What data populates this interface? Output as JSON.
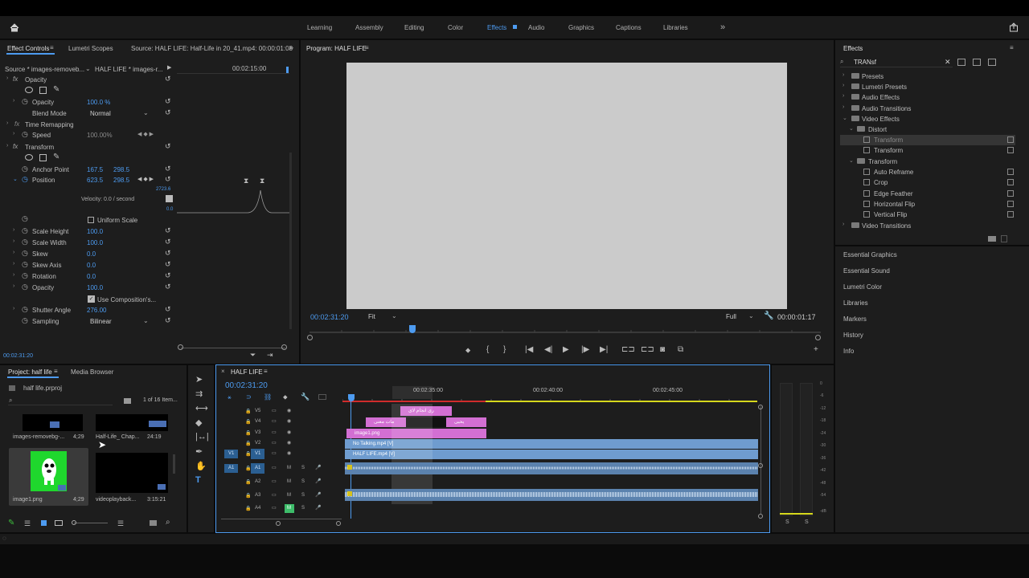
{
  "workspaces": {
    "items": [
      "Learning",
      "Assembly",
      "Editing",
      "Color",
      "Effects",
      "Audio",
      "Graphics",
      "Captions",
      "Libraries"
    ],
    "active": "Effects",
    "more": "»"
  },
  "ec": {
    "tabs": [
      "Effect Controls",
      "Lumetri Scopes",
      "Source: HALF LIFE: Half-Life in 20_41.mp4: 00:00:01:08"
    ],
    "source_label": "Source * images-removeb...",
    "seq_label": "HALF LIFE * images-r...",
    "ruler_time": "00:02:15:00",
    "opacity_section": "Opacity",
    "opacity_label": "Opacity",
    "opacity_value": "100.0 %",
    "blend_label": "Blend Mode",
    "blend_value": "Normal",
    "time_remap": "Time Remapping",
    "speed_label": "Speed",
    "speed_value": "100.00%",
    "transform_section": "Transform",
    "anchor_label": "Anchor Point",
    "anchor_x": "167.5",
    "anchor_y": "298.5",
    "position_label": "Position",
    "position_x": "623.5",
    "position_y": "298.5",
    "graph_max": "2723.6",
    "velocity": "Velocity: 0.0 / second",
    "graph_zero": "0.0",
    "uniform_scale": "Uniform Scale",
    "scale_height_label": "Scale Height",
    "scale_height": "100.0",
    "scale_width_label": "Scale Width",
    "scale_width": "100.0",
    "skew_label": "Skew",
    "skew": "0.0",
    "skew_axis_label": "Skew Axis",
    "skew_axis": "0.0",
    "rotation_label": "Rotation",
    "rotation": "0.0",
    "opacity2_label": "Opacity",
    "opacity2": "100.0",
    "use_comp": "Use Composition's...",
    "shutter_label": "Shutter Angle",
    "shutter": "276.00",
    "sampling_label": "Sampling",
    "sampling": "Bilinear",
    "footer_time": "00:02:31:20"
  },
  "program": {
    "title": "Program: HALF LIFE",
    "timecode": "00:02:31:20",
    "fit": "Fit",
    "quality": "Full",
    "duration": "00:00:01:17"
  },
  "effects": {
    "title": "Effects",
    "search_value": "TRANsf",
    "tree": [
      {
        "label": "Presets",
        "level": 0,
        "sel": false
      },
      {
        "label": "Lumetri Presets",
        "level": 0,
        "sel": false
      },
      {
        "label": "Audio Effects",
        "level": 0,
        "sel": false
      },
      {
        "label": "Audio Transitions",
        "level": 0,
        "sel": false
      },
      {
        "label": "Video Effects",
        "level": 0,
        "sel": false
      },
      {
        "label": "Distort",
        "level": 1,
        "sel": false
      },
      {
        "label": "Transform",
        "level": 2,
        "sel": true
      },
      {
        "label": "Transform",
        "level": 2,
        "sel": false
      },
      {
        "label": "Transform",
        "level": 1,
        "sel": false
      },
      {
        "label": "Auto Reframe",
        "level": 2,
        "sel": false
      },
      {
        "label": "Crop",
        "level": 2,
        "sel": false
      },
      {
        "label": "Edge Feather",
        "level": 2,
        "sel": false
      },
      {
        "label": "Horizontal Flip",
        "level": 2,
        "sel": false
      },
      {
        "label": "Vertical Flip",
        "level": 2,
        "sel": false
      },
      {
        "label": "Video Transitions",
        "level": 0,
        "sel": false
      }
    ],
    "sections": [
      "Essential Graphics",
      "Essential Sound",
      "Lumetri Color",
      "Libraries",
      "Markers",
      "History",
      "Info"
    ]
  },
  "project": {
    "tabs": [
      "Project: half life",
      "Media Browser"
    ],
    "file": "half life.prproj",
    "count": "1 of 16 Item...",
    "items": [
      {
        "name": "images-removebg-...",
        "dur": "4;29"
      },
      {
        "name": "Half-Life_ Chap...",
        "dur": "24:19"
      },
      {
        "name": "image1.png",
        "dur": "4;29"
      },
      {
        "name": "videoplayback...",
        "dur": "3:15:21"
      }
    ]
  },
  "timeline": {
    "title": "HALF LIFE",
    "timecode": "00:02:31:20",
    "ruler": [
      "00:02:35:00",
      "00:02:40:00",
      "00:02:45:00"
    ],
    "video_tracks": [
      "V5",
      "V4",
      "V3",
      "V2",
      "V1"
    ],
    "audio_tracks": [
      "A1",
      "A2",
      "A3",
      "A4"
    ],
    "src_v": "V1",
    "src_a": "A1",
    "clips": {
      "v5": "ری انجام لای",
      "v4a": "مات معنی",
      "v4b": "یحیی",
      "v3": "image1.png",
      "v2": "No Talking.mp4 [V]",
      "v1": "HALF LIFE.mp4 [V]"
    }
  },
  "meters": {
    "ticks": [
      "0",
      "-6",
      "-12",
      "-18",
      "-24",
      "-30",
      "-36",
      "-42",
      "-48",
      "-54",
      "-dB"
    ],
    "solo": [
      "S",
      "S"
    ]
  }
}
